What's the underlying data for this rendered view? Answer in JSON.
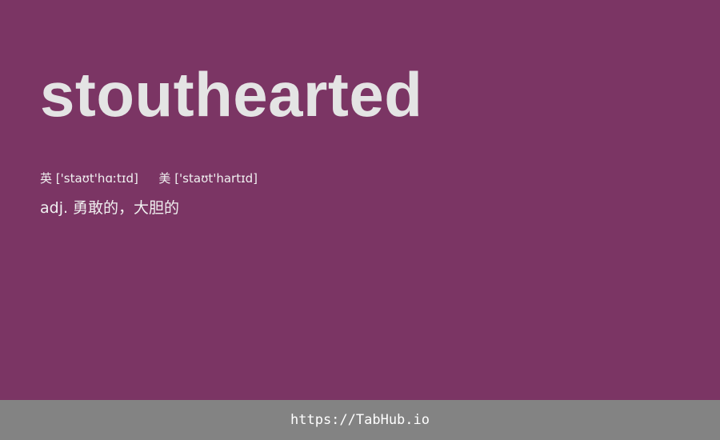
{
  "word": "stouthearted",
  "phonetic": {
    "uk_label": "英",
    "uk_ipa": "['staʊt'hɑːtɪd]",
    "us_label": "美",
    "us_ipa": "['staʊt'hartɪd]"
  },
  "definition": "adj. 勇敢的，大胆的",
  "footer": {
    "link_text": "https://TabHub.io"
  },
  "colors": {
    "background": "#7b3564",
    "footer_background": "#838383",
    "word_text": "#e4e4e4"
  }
}
